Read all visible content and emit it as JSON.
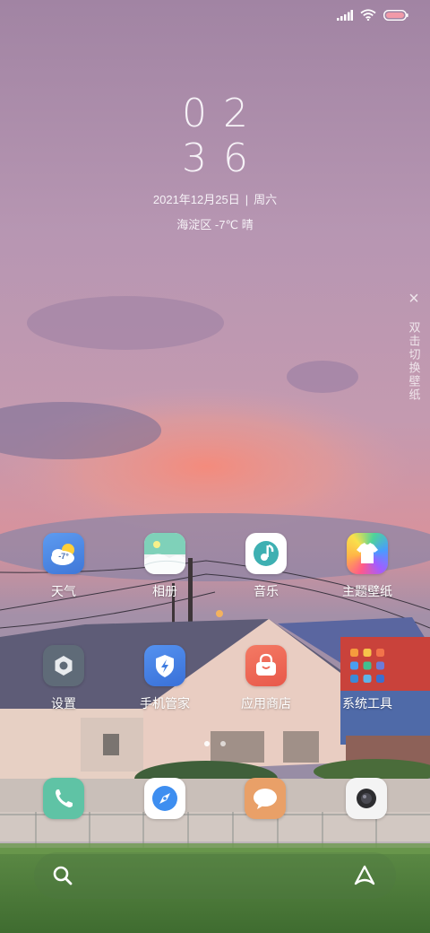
{
  "status_bar": {
    "icons": [
      "signal-icon",
      "wifi-icon",
      "battery-icon"
    ],
    "battery_color": "#f19aa8"
  },
  "clock": {
    "hours": "02",
    "minutes": "36",
    "date": "2021年12月25日",
    "weekday": "周六",
    "location": "海淀区",
    "temperature": "-7℃",
    "condition": "晴"
  },
  "side_hint": {
    "close_glyph": "×",
    "text": "双击切换壁纸"
  },
  "apps": [
    {
      "label": "天气",
      "icon": "weather-icon",
      "badge": "-7°"
    },
    {
      "label": "相册",
      "icon": "gallery-icon"
    },
    {
      "label": "音乐",
      "icon": "music-icon"
    },
    {
      "label": "主题壁纸",
      "icon": "themes-icon"
    },
    {
      "label": "设置",
      "icon": "settings-icon"
    },
    {
      "label": "手机管家",
      "icon": "security-icon"
    },
    {
      "label": "应用商店",
      "icon": "app-store-icon"
    },
    {
      "label": "系统工具",
      "icon": "system-tools-folder-icon"
    }
  ],
  "page_indicator": {
    "count": 2,
    "active": 1
  },
  "dock": [
    "phone-icon",
    "browser-icon",
    "messages-icon",
    "camera-icon"
  ],
  "bottom_bar": [
    "search-icon",
    "assistant-icon"
  ],
  "colors": {
    "sky_top": "#a88aa7",
    "sky_glow": "#f28c7d",
    "grass": "#4d7a3c",
    "weather": "#4b86df",
    "gallery": "#e8eef0",
    "music": "#ffffff",
    "settings": "#5f6b78",
    "security": "#3f7ce0",
    "app_store": "#ee6a58",
    "phone": "#5fc3a5",
    "messages": "#e9a068"
  }
}
